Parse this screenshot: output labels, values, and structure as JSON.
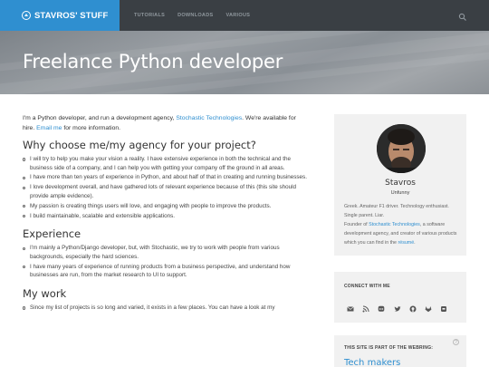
{
  "brand": {
    "name": "STAVROS' STUFF"
  },
  "nav": {
    "items": [
      "TUTORIALS",
      "DOWNLOADS",
      "VARIOUS"
    ]
  },
  "hero": {
    "title": "Freelance Python developer"
  },
  "intro": {
    "text_before": "I'm a Python developer, and run a development agency, ",
    "agency_link": "Stochastic Technologies",
    "text_middle": ". We're available for hire. ",
    "email_link": "Email me",
    "text_after": " for more information."
  },
  "sections": {
    "why": {
      "heading": "Why choose me/my agency for your project?",
      "items": [
        "I will try to help you make your vision a reality. I have extensive experience in both the technical and the business side of a company, and I can help you with getting your company off the ground in all areas.",
        "I have more than ten years of experience in Python, and about half of that in creating and running businesses.",
        "I love development overall, and have gathered lots of relevant experience because of this (this site should provide ample evidence).",
        "My passion is creating things users will love, and engaging with people to improve the products.",
        "I build maintainable, scalable and extensible applications."
      ]
    },
    "experience": {
      "heading": "Experience",
      "items": [
        "I'm mainly a Python/Django developer, but, with Stochastic, we try to work with people from various backgrounds, especially the hard sciences.",
        "I have many years of experience of running products from a business perspective, and understand how businesses are run, from the market research to UI to support."
      ]
    },
    "work": {
      "heading": "My work",
      "items": [
        "Since my list of projects is so long and varied, it exists in a few places. You can have a look at my"
      ]
    }
  },
  "profile": {
    "name": "Stavros",
    "tagline": "Unfunny",
    "bio_line1": "Greek. Amateur F1 driver. Technology enthusiast. Single parent. Liar.",
    "bio_before": "Founder of ",
    "bio_link": "Stochastic Technologies",
    "bio_middle": ", a software development agency, and creator of various products which you can find in the ",
    "resume_link": "résumé",
    "bio_end": "."
  },
  "connect": {
    "title": "CONNECT WITH ME",
    "icons": [
      "email-icon",
      "rss-icon",
      "mastodon-icon",
      "twitter-icon",
      "github-icon",
      "gitlab-icon",
      "keybase-icon"
    ]
  },
  "webring": {
    "title": "THIS SITE IS PART OF THE WEBRING:",
    "help": "?",
    "name": "Tech makers"
  },
  "colors": {
    "accent": "#2f8fd0",
    "navbar": "#3a3f44",
    "sidebar_card": "#f1f1f1"
  }
}
